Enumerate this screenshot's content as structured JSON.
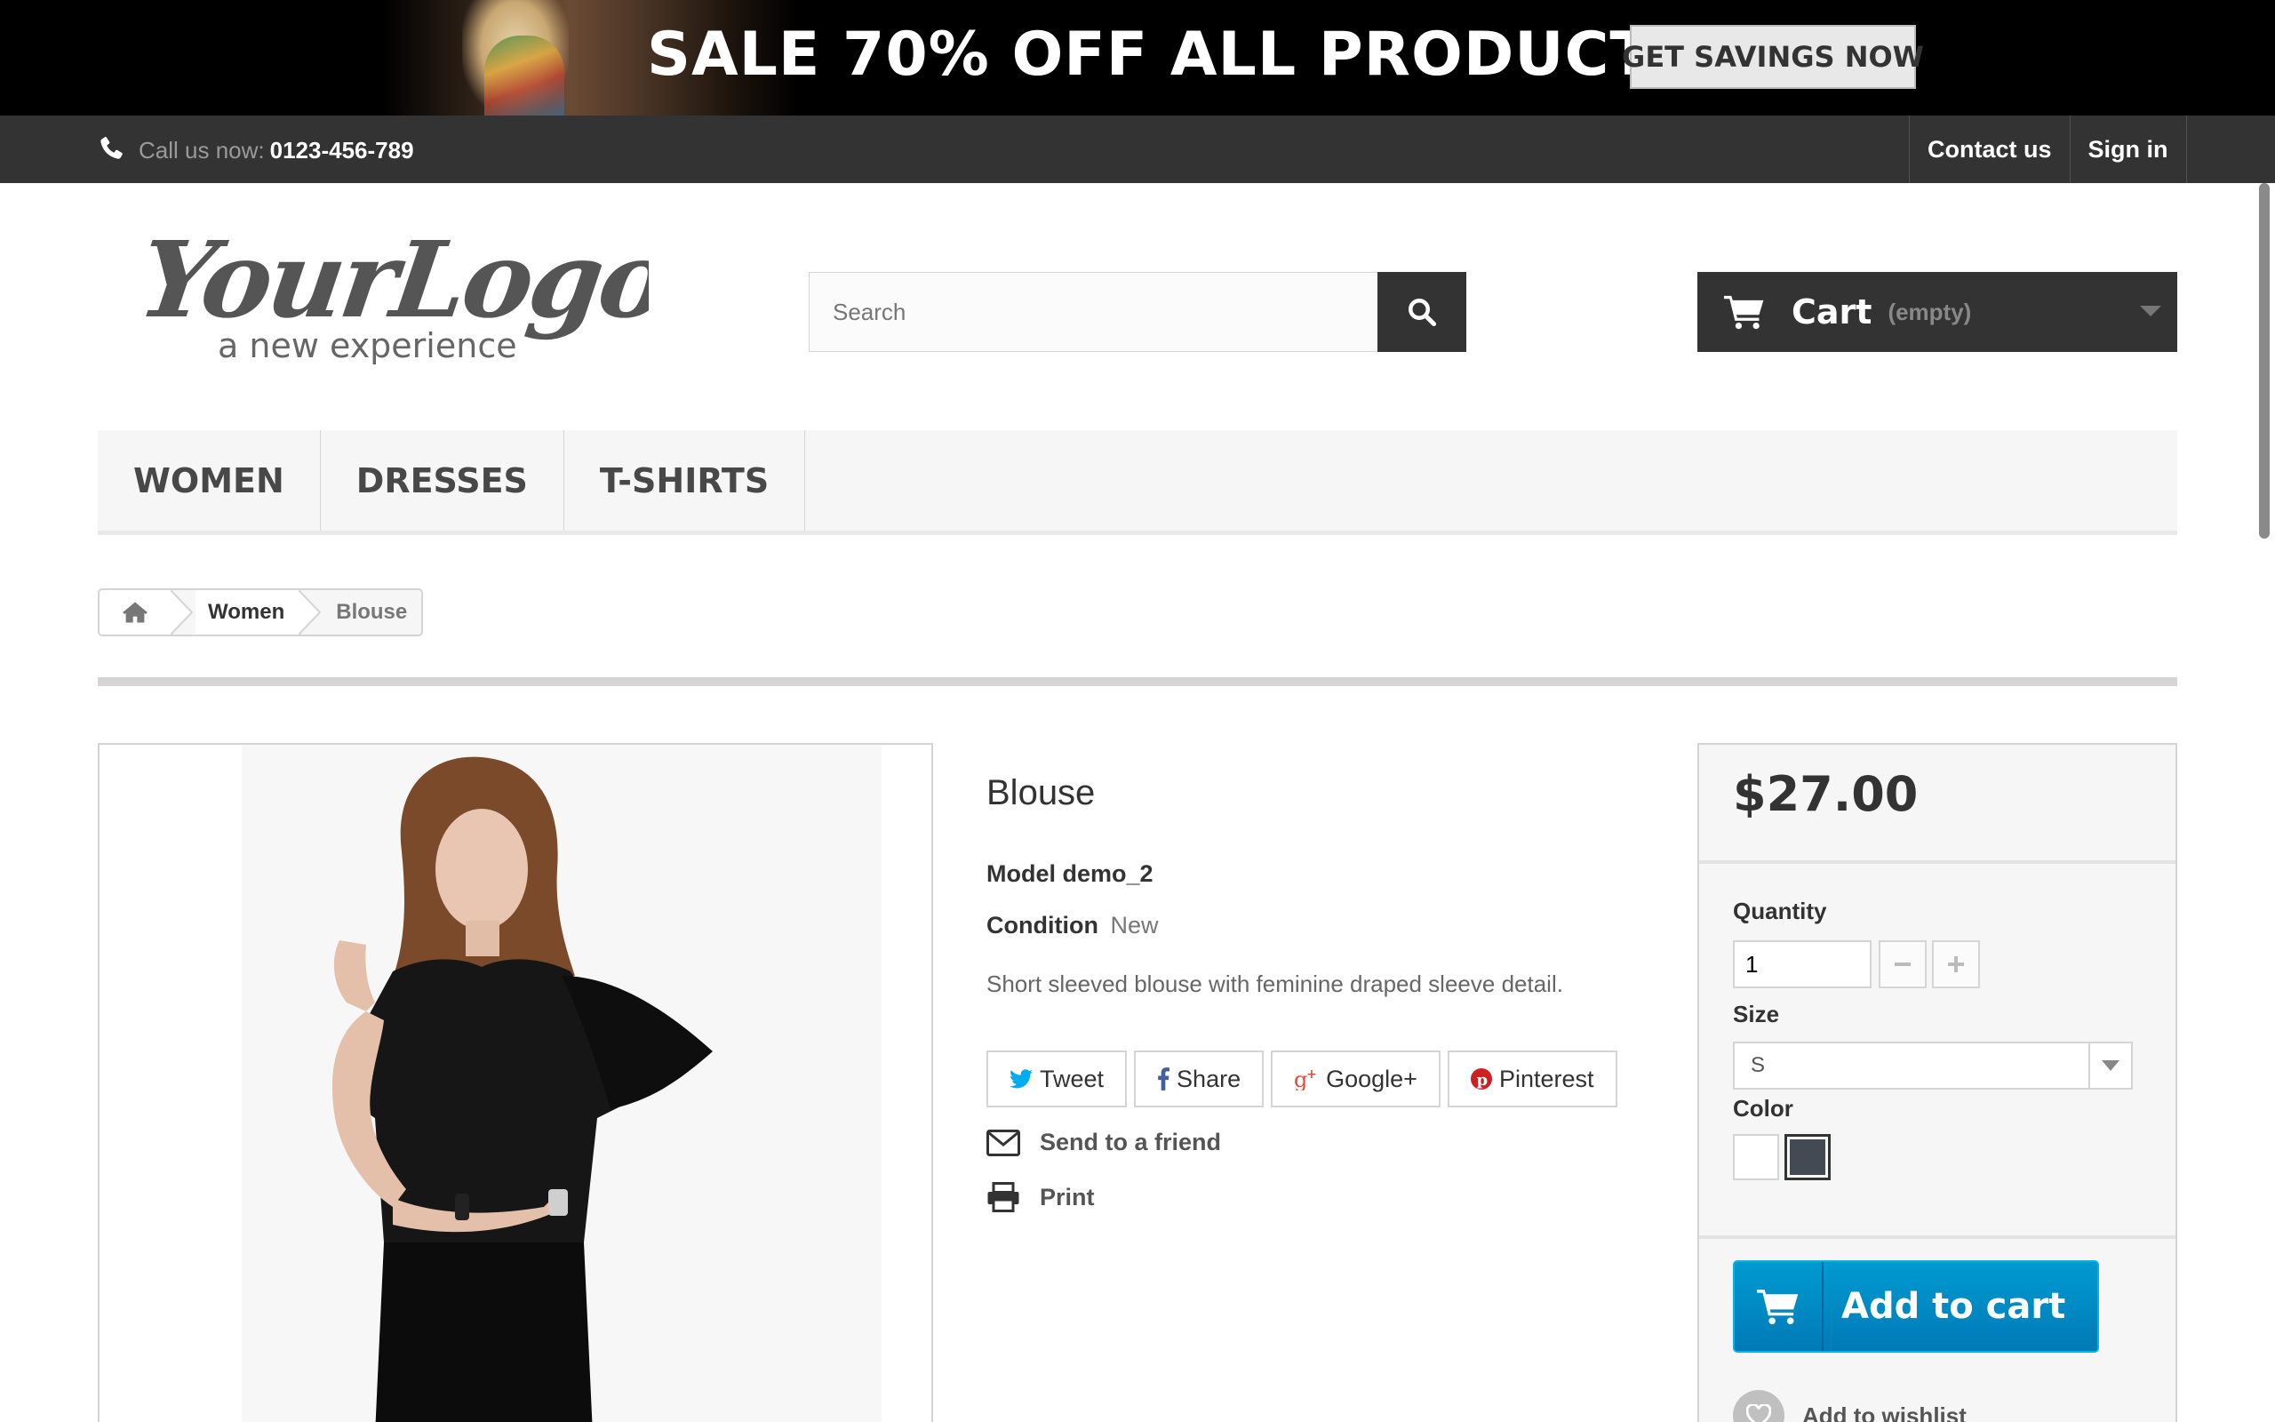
{
  "banner": {
    "text": "SALE 70% OFF ALL PRODUCTS",
    "button": "GET SAVINGS NOW"
  },
  "topbar": {
    "call_label": "Call us now:",
    "phone": "0123-456-789",
    "links": [
      "Contact us",
      "Sign in"
    ]
  },
  "header": {
    "logo_main": "YourLogo",
    "logo_tagline": "a new experience",
    "search_placeholder": "Search",
    "cart_label": "Cart",
    "cart_status": "(empty)"
  },
  "menu": {
    "items": [
      "WOMEN",
      "DRESSES",
      "T-SHIRTS"
    ]
  },
  "breadcrumb": {
    "home_icon": "home-icon",
    "items": [
      "Women",
      "Blouse"
    ]
  },
  "product": {
    "name": "Blouse",
    "model_label": "Model",
    "model": "demo_2",
    "condition_label": "Condition",
    "condition": "New",
    "description": "Short sleeved blouse with feminine draped sleeve detail.",
    "social": [
      "Tweet",
      "Share",
      "Google+",
      "Pinterest"
    ],
    "actions": [
      "Send to a friend",
      "Print"
    ]
  },
  "buy": {
    "price": "$27.00",
    "quantity_label": "Quantity",
    "quantity": "1",
    "size_label": "Size",
    "size": "S",
    "color_label": "Color",
    "colors": [
      "#ffffff",
      "#434a54"
    ],
    "selected_color": "#434a54",
    "add_to_cart": "Add to cart",
    "wishlist": "Add to wishlist"
  },
  "colors": {
    "dark": "#333333",
    "accent_blue": "#009ad0",
    "border": "#d6d4d4"
  }
}
